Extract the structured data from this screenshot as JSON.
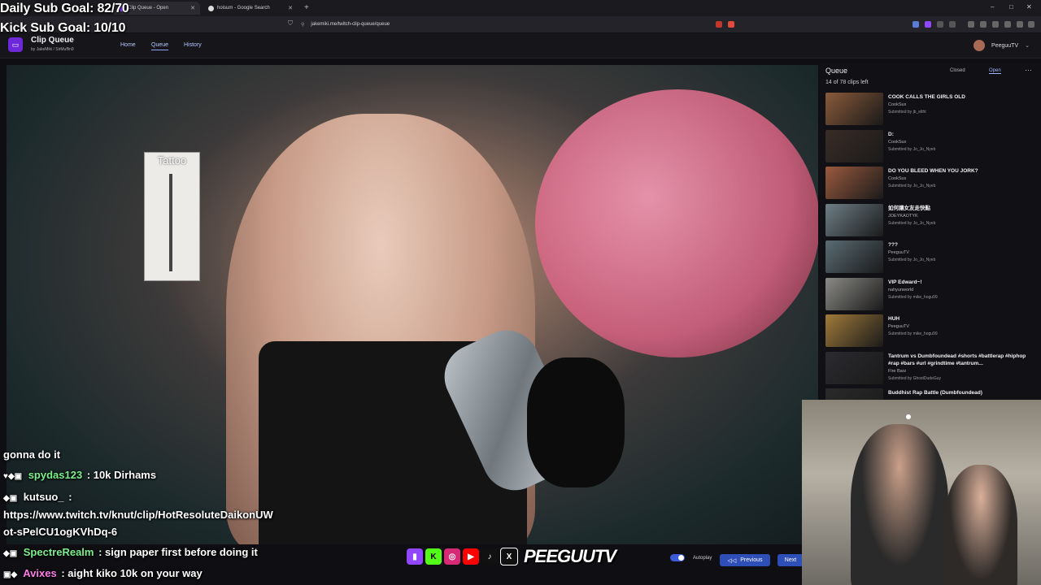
{
  "browser": {
    "tabs": [
      {
        "label": "Clip Queue - Open",
        "active": true
      },
      {
        "label": "hoisum - Google Search",
        "active": false
      }
    ],
    "new_tab": "+",
    "url": "jakemiki.me/twitch-clip-queue/queue",
    "window_controls": [
      "–",
      "□",
      "✕"
    ]
  },
  "overlay": {
    "daily_goal": "Daily Sub Goal: 82/70",
    "kick_goal": "Kick Sub Goal: 10/10"
  },
  "app": {
    "name": "Clip Queue",
    "byline": "by JakeMiki / SirMuffin9",
    "nav": [
      "Home",
      "Queue",
      "History"
    ],
    "active_nav": "Queue",
    "profile_name": "PeeguuTV"
  },
  "video": {
    "card_label": "Tattoo"
  },
  "chat": [
    {
      "user": "",
      "text": "gonna do it"
    },
    {
      "user": "spydas123",
      "text": ": 10k Dirhams",
      "color": "#7cf08a"
    },
    {
      "user": "kutsuo_",
      "text": ":",
      "color": "#ffffff"
    },
    {
      "user": "",
      "text": "https://www.twitch.tv/knut/clip/HotResoluteDaikonUW"
    },
    {
      "user": "",
      "text": "ot-sPelCU1ogKVhDq-6"
    },
    {
      "user": "SpectreRealm",
      "text": ": sign paper first before doing it",
      "color": "#7cf08a"
    },
    {
      "user": "Avixes",
      "text": ": aight kiko 10k on your way",
      "color": "#ff7de9"
    }
  ],
  "controls": {
    "brand": "PEEGUUTV",
    "autoplay_label": "Autoplay",
    "autoplay_on": true,
    "previous_label": "Previous",
    "next_label": "Next"
  },
  "queue": {
    "title": "Queue",
    "count": "14 of 78 clips left",
    "closed_label": "Closed",
    "open_label": "Open",
    "items": [
      {
        "title": "COOK CALLS THE GIRLS OLD",
        "channel": "CookSux",
        "submitter": "Submitted by jb_eltht",
        "thumb": "#8a5a3a"
      },
      {
        "title": "D:",
        "channel": "CookSux",
        "submitter": "Submitted by Jo_Jo_Nyeb",
        "thumb": "#3a2c26"
      },
      {
        "title": "DO YOU BLEED WHEN YOU JORK?",
        "channel": "CookSux",
        "submitter": "Submitted by Jo_Jo_Nyeb",
        "thumb": "#9a5a3e"
      },
      {
        "title": "如何讓女友走快點",
        "channel": "JOEYKAOTYK",
        "submitter": "Submitted by Jo_Jo_Nyeb",
        "thumb": "#6e7f86"
      },
      {
        "title": "???",
        "channel": "PeeguuTV",
        "submitter": "Submitted by Jo_Jo_Nyeb",
        "thumb": "#5a6c74"
      },
      {
        "title": "VIP Edward~!",
        "channel": "nahyunworld",
        "submitter": "Submitted by mike_hogu99",
        "thumb": "#8b8a86"
      },
      {
        "title": "HUH",
        "channel": "PeeguuTV",
        "submitter": "Submitted by mike_hogu99",
        "thumb": "#a07a3a"
      },
      {
        "title": "Tantrum vs Dumbfoundead #shorts #battlerap #hiphop #rap #bars #url #grindtime #tantrum...",
        "channel": "Fire Barz",
        "submitter": "Submitted by GhostDudeGuy",
        "thumb": "#2b2b30"
      },
      {
        "title": "Buddhist Rap Battle (Dumbfoundead)",
        "channel": "",
        "submitter": "",
        "thumb": "#2a2a2a"
      }
    ]
  }
}
